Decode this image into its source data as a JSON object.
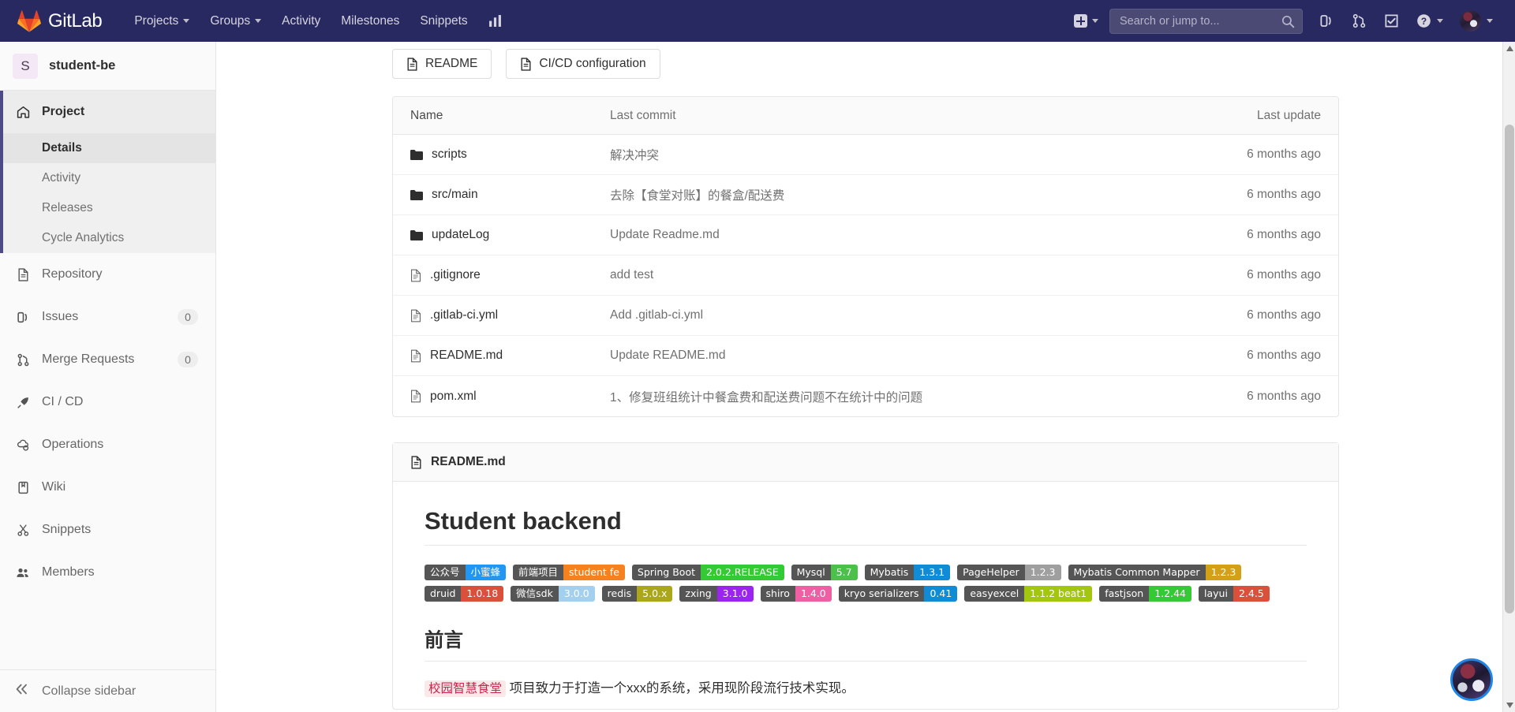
{
  "navbar": {
    "brand": "GitLab",
    "links": [
      {
        "label": "Projects",
        "caret": true
      },
      {
        "label": "Groups",
        "caret": true
      },
      {
        "label": "Activity",
        "caret": false
      },
      {
        "label": "Milestones",
        "caret": false
      },
      {
        "label": "Snippets",
        "caret": false
      }
    ],
    "analytics_icon": "chart-icon",
    "create_new_icon": "plus-square-icon",
    "search": {
      "placeholder": "Search or jump to...",
      "value": "",
      "icon": "search-icon"
    },
    "right_icons": [
      {
        "name": "issues-icon"
      },
      {
        "name": "merge-requests-icon"
      },
      {
        "name": "todos-icon"
      },
      {
        "name": "help-icon"
      }
    ],
    "avatar": "user-avatar"
  },
  "sidebar": {
    "project": {
      "initial": "S",
      "name": "student-be"
    },
    "items": [
      {
        "label": "Project",
        "icon": "home-icon",
        "active": true,
        "count": null
      },
      {
        "label": "Repository",
        "icon": "document-icon",
        "active": false,
        "count": null
      },
      {
        "label": "Issues",
        "icon": "issues-icon",
        "active": false,
        "count": "0"
      },
      {
        "label": "Merge Requests",
        "icon": "merge-requests-icon",
        "active": false,
        "count": "0"
      },
      {
        "label": "CI / CD",
        "icon": "rocket-icon",
        "active": false,
        "count": null
      },
      {
        "label": "Operations",
        "icon": "cloud-gear-icon",
        "active": false,
        "count": null
      },
      {
        "label": "Wiki",
        "icon": "book-icon",
        "active": false,
        "count": null
      },
      {
        "label": "Snippets",
        "icon": "scissors-icon",
        "active": false,
        "count": null
      },
      {
        "label": "Members",
        "icon": "users-icon",
        "active": false,
        "count": null
      }
    ],
    "sub_items": [
      {
        "label": "Details",
        "active": true
      },
      {
        "label": "Activity",
        "active": false
      },
      {
        "label": "Releases",
        "active": false
      },
      {
        "label": "Cycle Analytics",
        "active": false
      }
    ],
    "collapse": {
      "label": "Collapse sidebar",
      "icon": "double-chevron-left-icon"
    }
  },
  "toolbar": {
    "readme_button": "README",
    "cicd_button": "CI/CD configuration"
  },
  "file_tree": {
    "headers": {
      "name": "Name",
      "last_commit": "Last commit",
      "last_update": "Last update"
    },
    "rows": [
      {
        "name": "scripts",
        "type": "folder",
        "commit": "解决冲突",
        "updated": "6 months ago"
      },
      {
        "name": "src/main",
        "type": "folder",
        "commit": "去除【食堂对账】的餐盒/配送费",
        "updated": "6 months ago"
      },
      {
        "name": "updateLog",
        "type": "folder",
        "commit": "Update Readme.md",
        "updated": "6 months ago"
      },
      {
        "name": ".gitignore",
        "type": "file",
        "commit": "add test",
        "updated": "6 months ago"
      },
      {
        "name": ".gitlab-ci.yml",
        "type": "file",
        "commit": "Add .gitlab-ci.yml",
        "updated": "6 months ago"
      },
      {
        "name": "README.md",
        "type": "file",
        "commit": "Update README.md",
        "updated": "6 months ago"
      },
      {
        "name": "pom.xml",
        "type": "file",
        "commit": "1、修复班组统计中餐盒费和配送费问题不在统计中的问题",
        "updated": "6 months ago"
      }
    ]
  },
  "readme": {
    "card_title": "README.md",
    "title": "Student backend",
    "badges": [
      {
        "left": "公众号",
        "right": "小蜜蜂",
        "left_color": "#555555",
        "right_color": "#2196f3"
      },
      {
        "left": "前端项目",
        "right": "student fe",
        "left_color": "#555555",
        "right_color": "#f58220"
      },
      {
        "left": "Spring Boot",
        "right": "2.0.2.RELEASE",
        "left_color": "#555555",
        "right_color": "#35c935"
      },
      {
        "left": "Mysql",
        "right": "5.7",
        "left_color": "#555555",
        "right_color": "#4bc04b"
      },
      {
        "left": "Mybatis",
        "right": "1.3.1",
        "left_color": "#555555",
        "right_color": "#108cd6"
      },
      {
        "left": "PageHelper",
        "right": "1.2.3",
        "left_color": "#555555",
        "right_color": "#9f9f9f"
      },
      {
        "left": "Mybatis Common Mapper",
        "right": "1.2.3",
        "left_color": "#555555",
        "right_color": "#d4a017"
      },
      {
        "left": "druid",
        "right": "1.0.18",
        "left_color": "#555555",
        "right_color": "#d9513b"
      },
      {
        "left": "微信sdk",
        "right": "3.0.0",
        "left_color": "#555555",
        "right_color": "#a4d0ef"
      },
      {
        "left": "redis",
        "right": "5.0.x",
        "left_color": "#555555",
        "right_color": "#aaa71b"
      },
      {
        "left": "zxing",
        "right": "3.1.0",
        "left_color": "#555555",
        "right_color": "#9b24f0"
      },
      {
        "left": "shiro",
        "right": "1.4.0",
        "left_color": "#555555",
        "right_color": "#ef5fa3"
      },
      {
        "left": "kryo serializers",
        "right": "0.41",
        "left_color": "#555555",
        "right_color": "#108cd6"
      },
      {
        "left": "easyexcel",
        "right": "1.1.2 beat1",
        "left_color": "#555555",
        "right_color": "#a3c610"
      },
      {
        "left": "fastjson",
        "right": "1.2.44",
        "left_color": "#555555",
        "right_color": "#35c935"
      },
      {
        "left": "layui",
        "right": "2.4.5",
        "left_color": "#555555",
        "right_color": "#d9513b"
      }
    ],
    "section_title": "前言",
    "paragraph_code": "校园智慧食堂",
    "paragraph_text": " 项目致力于打造一个xxx的系统，采用现阶段流行技术实现。"
  },
  "float_widget": {
    "name": "floating-user-avatar"
  },
  "scrollbar": {
    "up": "scroll-up-arrow",
    "down": "scroll-down-arrow"
  }
}
